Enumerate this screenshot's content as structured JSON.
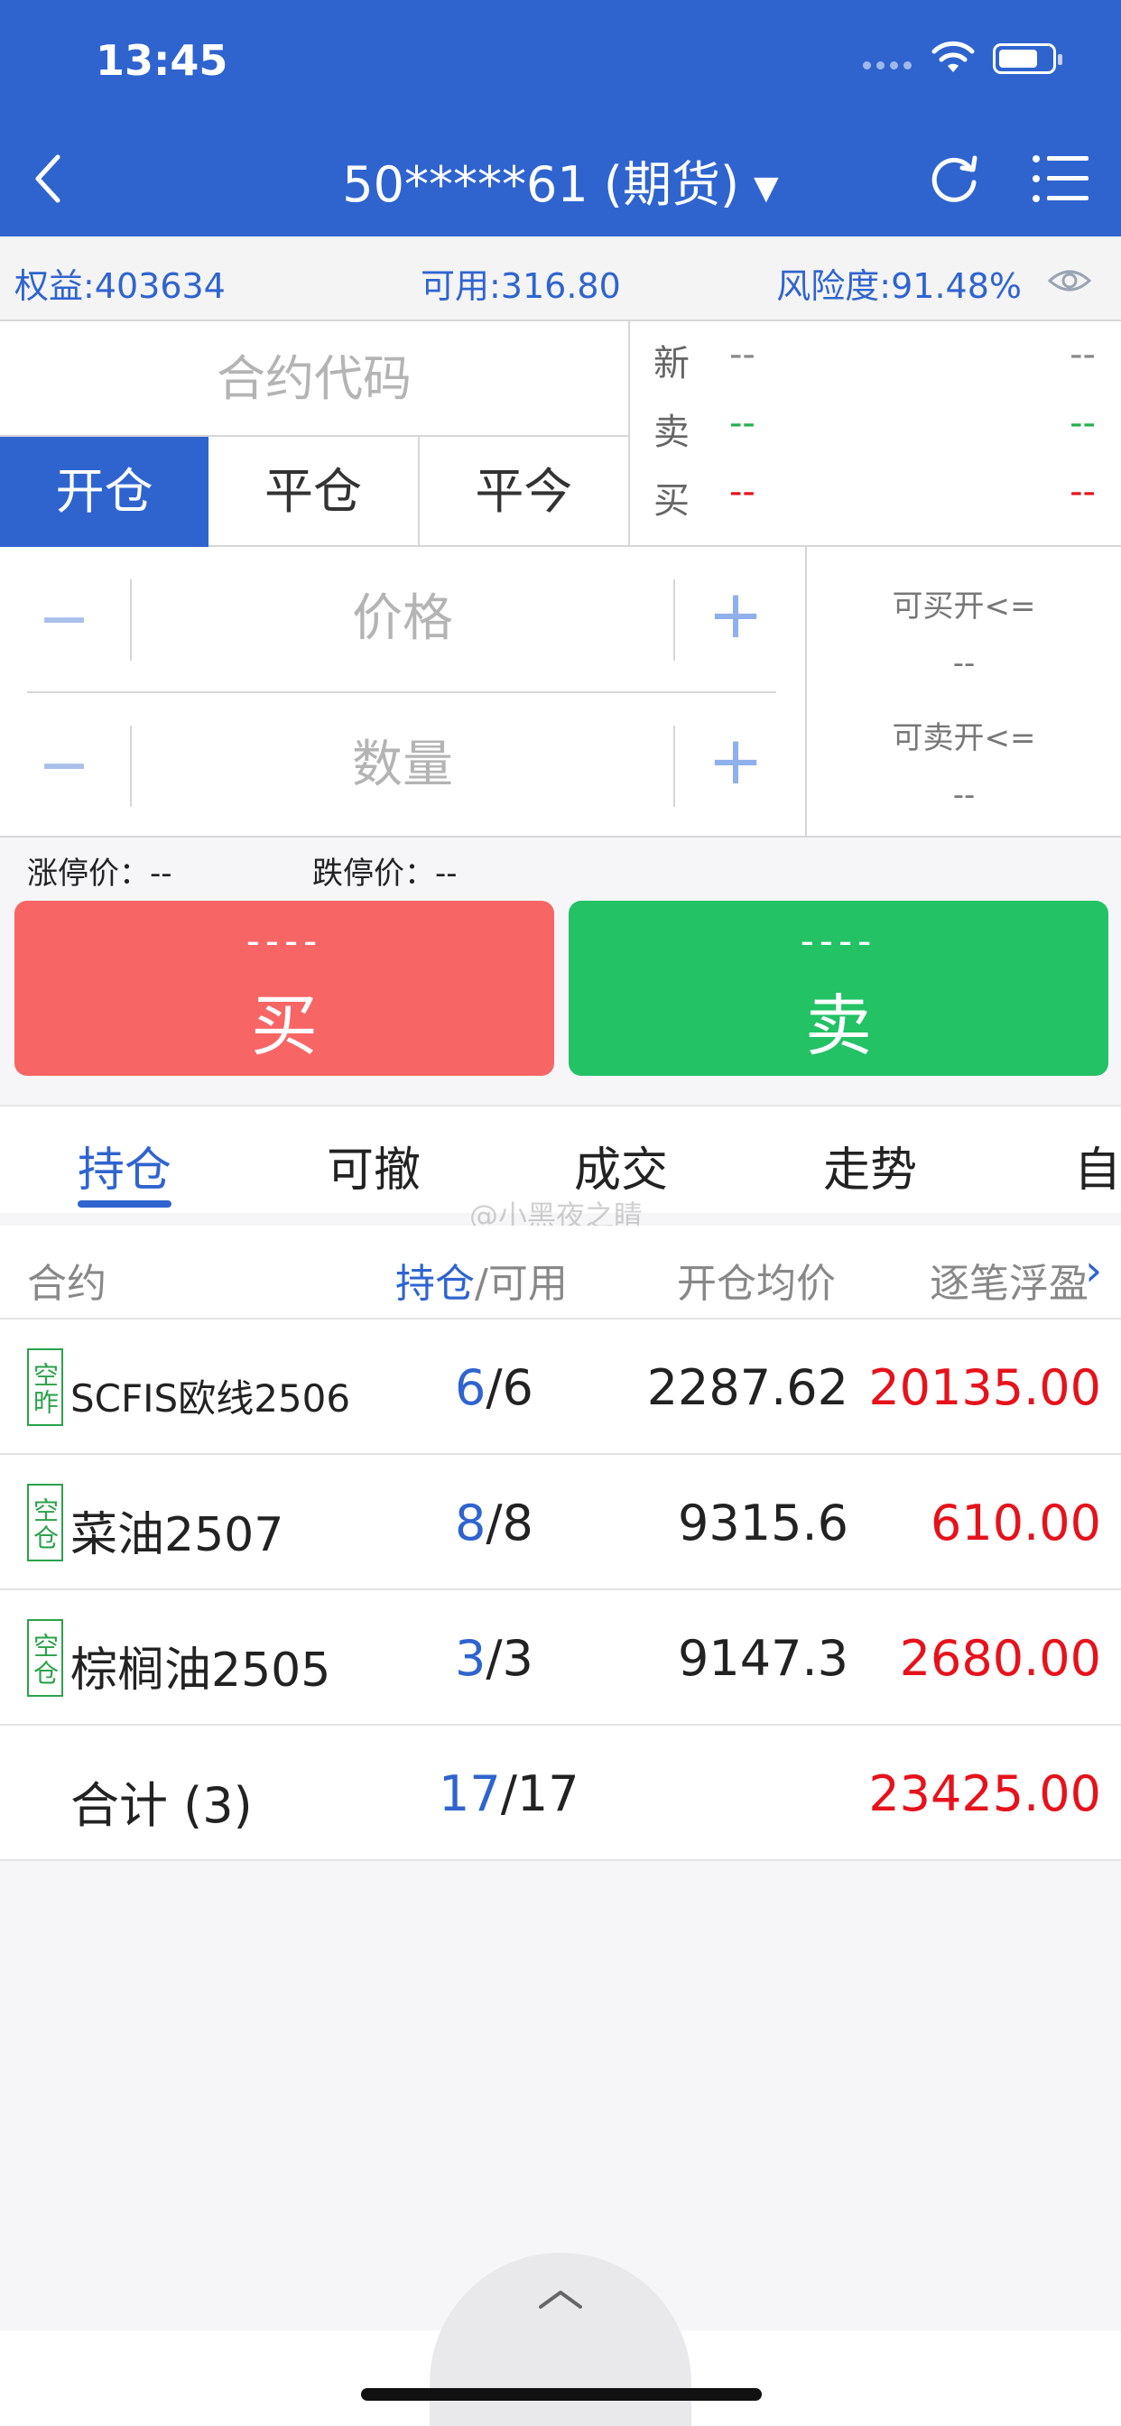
{
  "status_bar": {
    "time": "13:45"
  },
  "header": {
    "title": "50*****61 (期货)"
  },
  "account": {
    "equity": "权益:403634",
    "available": "可用:316.80",
    "risk": "风险度:91.48%"
  },
  "order": {
    "contract_placeholder": "合约代码",
    "modes": [
      "开仓",
      "平仓",
      "平今"
    ],
    "quotes": [
      {
        "label": "新",
        "v1": "--",
        "v2": "--"
      },
      {
        "label": "卖",
        "v1": "--",
        "v2": "--"
      },
      {
        "label": "买",
        "v1": "--",
        "v2": "--"
      }
    ],
    "price_placeholder": "价格",
    "qty_placeholder": "数量",
    "minus": "−",
    "plus": "+",
    "can_buy_label": "可买开<=",
    "can_buy_value": "--",
    "can_sell_label": "可卖开<=",
    "can_sell_value": "--",
    "limit_up": "涨停价：--",
    "limit_down": "跌停价：--",
    "buy": {
      "price": "----",
      "label": "买"
    },
    "sell": {
      "price": "----",
      "label": "卖"
    }
  },
  "colors": {
    "primary": "#2f64cf",
    "buy": "#f86565",
    "sell": "#22c265",
    "profit": "#e6121b",
    "badge": "#2aa24a"
  },
  "tabs": [
    "持仓",
    "可撤",
    "成交",
    "走势",
    "自"
  ],
  "watermark": "@小黑夜之睛",
  "positions": {
    "headers": {
      "contract": "合约",
      "hold": "持仓",
      "slash_avail": "/可用",
      "avg_price": "开仓均价",
      "pnl": "逐笔浮盈",
      "more": "›"
    },
    "rows": [
      {
        "badge": "空昨",
        "name": "SCFIS欧线2506",
        "hold": "6",
        "avail": "/6",
        "avg": "2287.62",
        "pnl": "20135.00"
      },
      {
        "badge": "空仓",
        "name": "菜油2507",
        "hold": "8",
        "avail": "/8",
        "avg": "9315.6",
        "pnl": "610.00"
      },
      {
        "badge": "空仓",
        "name": "棕榈油2505",
        "hold": "3",
        "avail": "/3",
        "avg": "9147.3",
        "pnl": "2680.00"
      }
    ],
    "total": {
      "label": "合计 (3)",
      "hold": "17",
      "avail": "/17",
      "pnl": "23425.00"
    }
  }
}
